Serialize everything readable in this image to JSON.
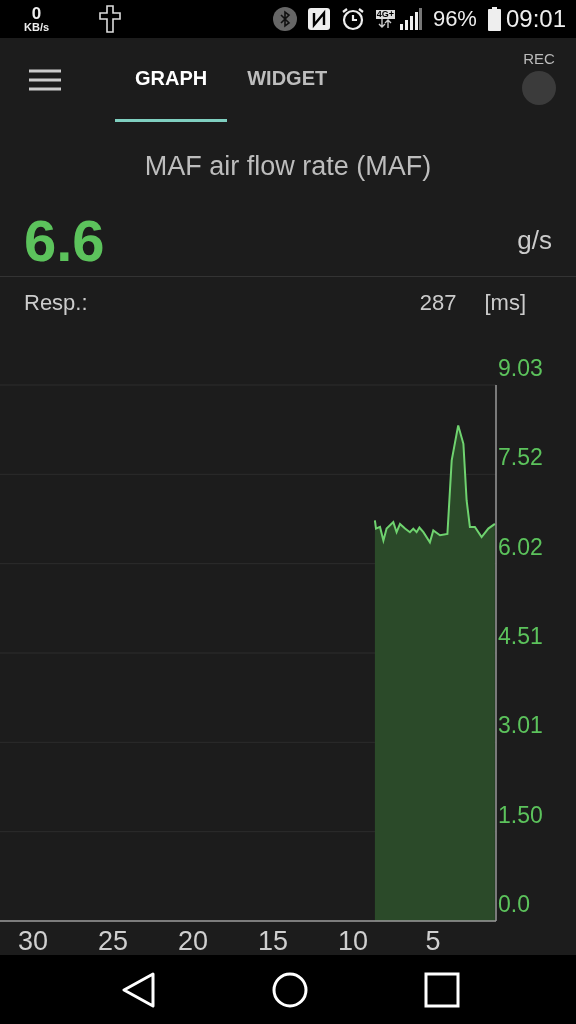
{
  "status_bar": {
    "speed_value": "0",
    "speed_unit": "KB/s",
    "network": "4G+",
    "battery": "96%",
    "time": "09:01"
  },
  "app_bar": {
    "tabs": [
      {
        "label": "GRAPH",
        "selected": true
      },
      {
        "label": "WIDGET",
        "selected": false
      }
    ],
    "rec_label": "REC"
  },
  "sensor": {
    "title": "MAF air flow rate (MAF)",
    "value": "6.6",
    "unit": "g/s",
    "response_label": "Resp.:",
    "response_value": "287",
    "response_unit": "[ms]"
  },
  "graph": {
    "chart_data": {
      "type": "area",
      "xlim": [
        32.06,
        1.06
      ],
      "ylim": [
        0,
        9.03
      ],
      "xticks": [
        30,
        25,
        20,
        15,
        10,
        5
      ],
      "yticks": [
        {
          "value": 0,
          "label": "0.0"
        },
        {
          "value": 1.505,
          "label": "1.50"
        },
        {
          "value": 3.01,
          "label": "3.01"
        },
        {
          "value": 4.515,
          "label": "4.51"
        },
        {
          "value": 6.02,
          "label": "6.02"
        },
        {
          "value": 7.525,
          "label": "7.52"
        },
        {
          "value": 9.03,
          "label": "9.03"
        }
      ],
      "x": [
        8.63,
        8.56,
        8.31,
        8.1,
        7.9,
        7.48,
        7.27,
        7.06,
        6.75,
        6.44,
        6.23,
        6.02,
        5.85,
        5.6,
        5.19,
        4.98,
        4.56,
        4.1,
        3.83,
        3.42,
        3.1,
        2.9,
        2.69,
        2.38,
        1.96,
        1.54,
        1.13
      ],
      "grid": true,
      "series": [
        {
          "color": "#6fd36f",
          "values": [
            6.75,
            6.61,
            6.64,
            6.41,
            6.61,
            6.72,
            6.55,
            6.69,
            6.61,
            6.55,
            6.61,
            6.55,
            6.63,
            6.55,
            6.38,
            6.58,
            6.5,
            6.52,
            7.76,
            8.35,
            8.04,
            7.09,
            6.64,
            6.64,
            6.47,
            6.61,
            6.69
          ]
        }
      ]
    }
  }
}
